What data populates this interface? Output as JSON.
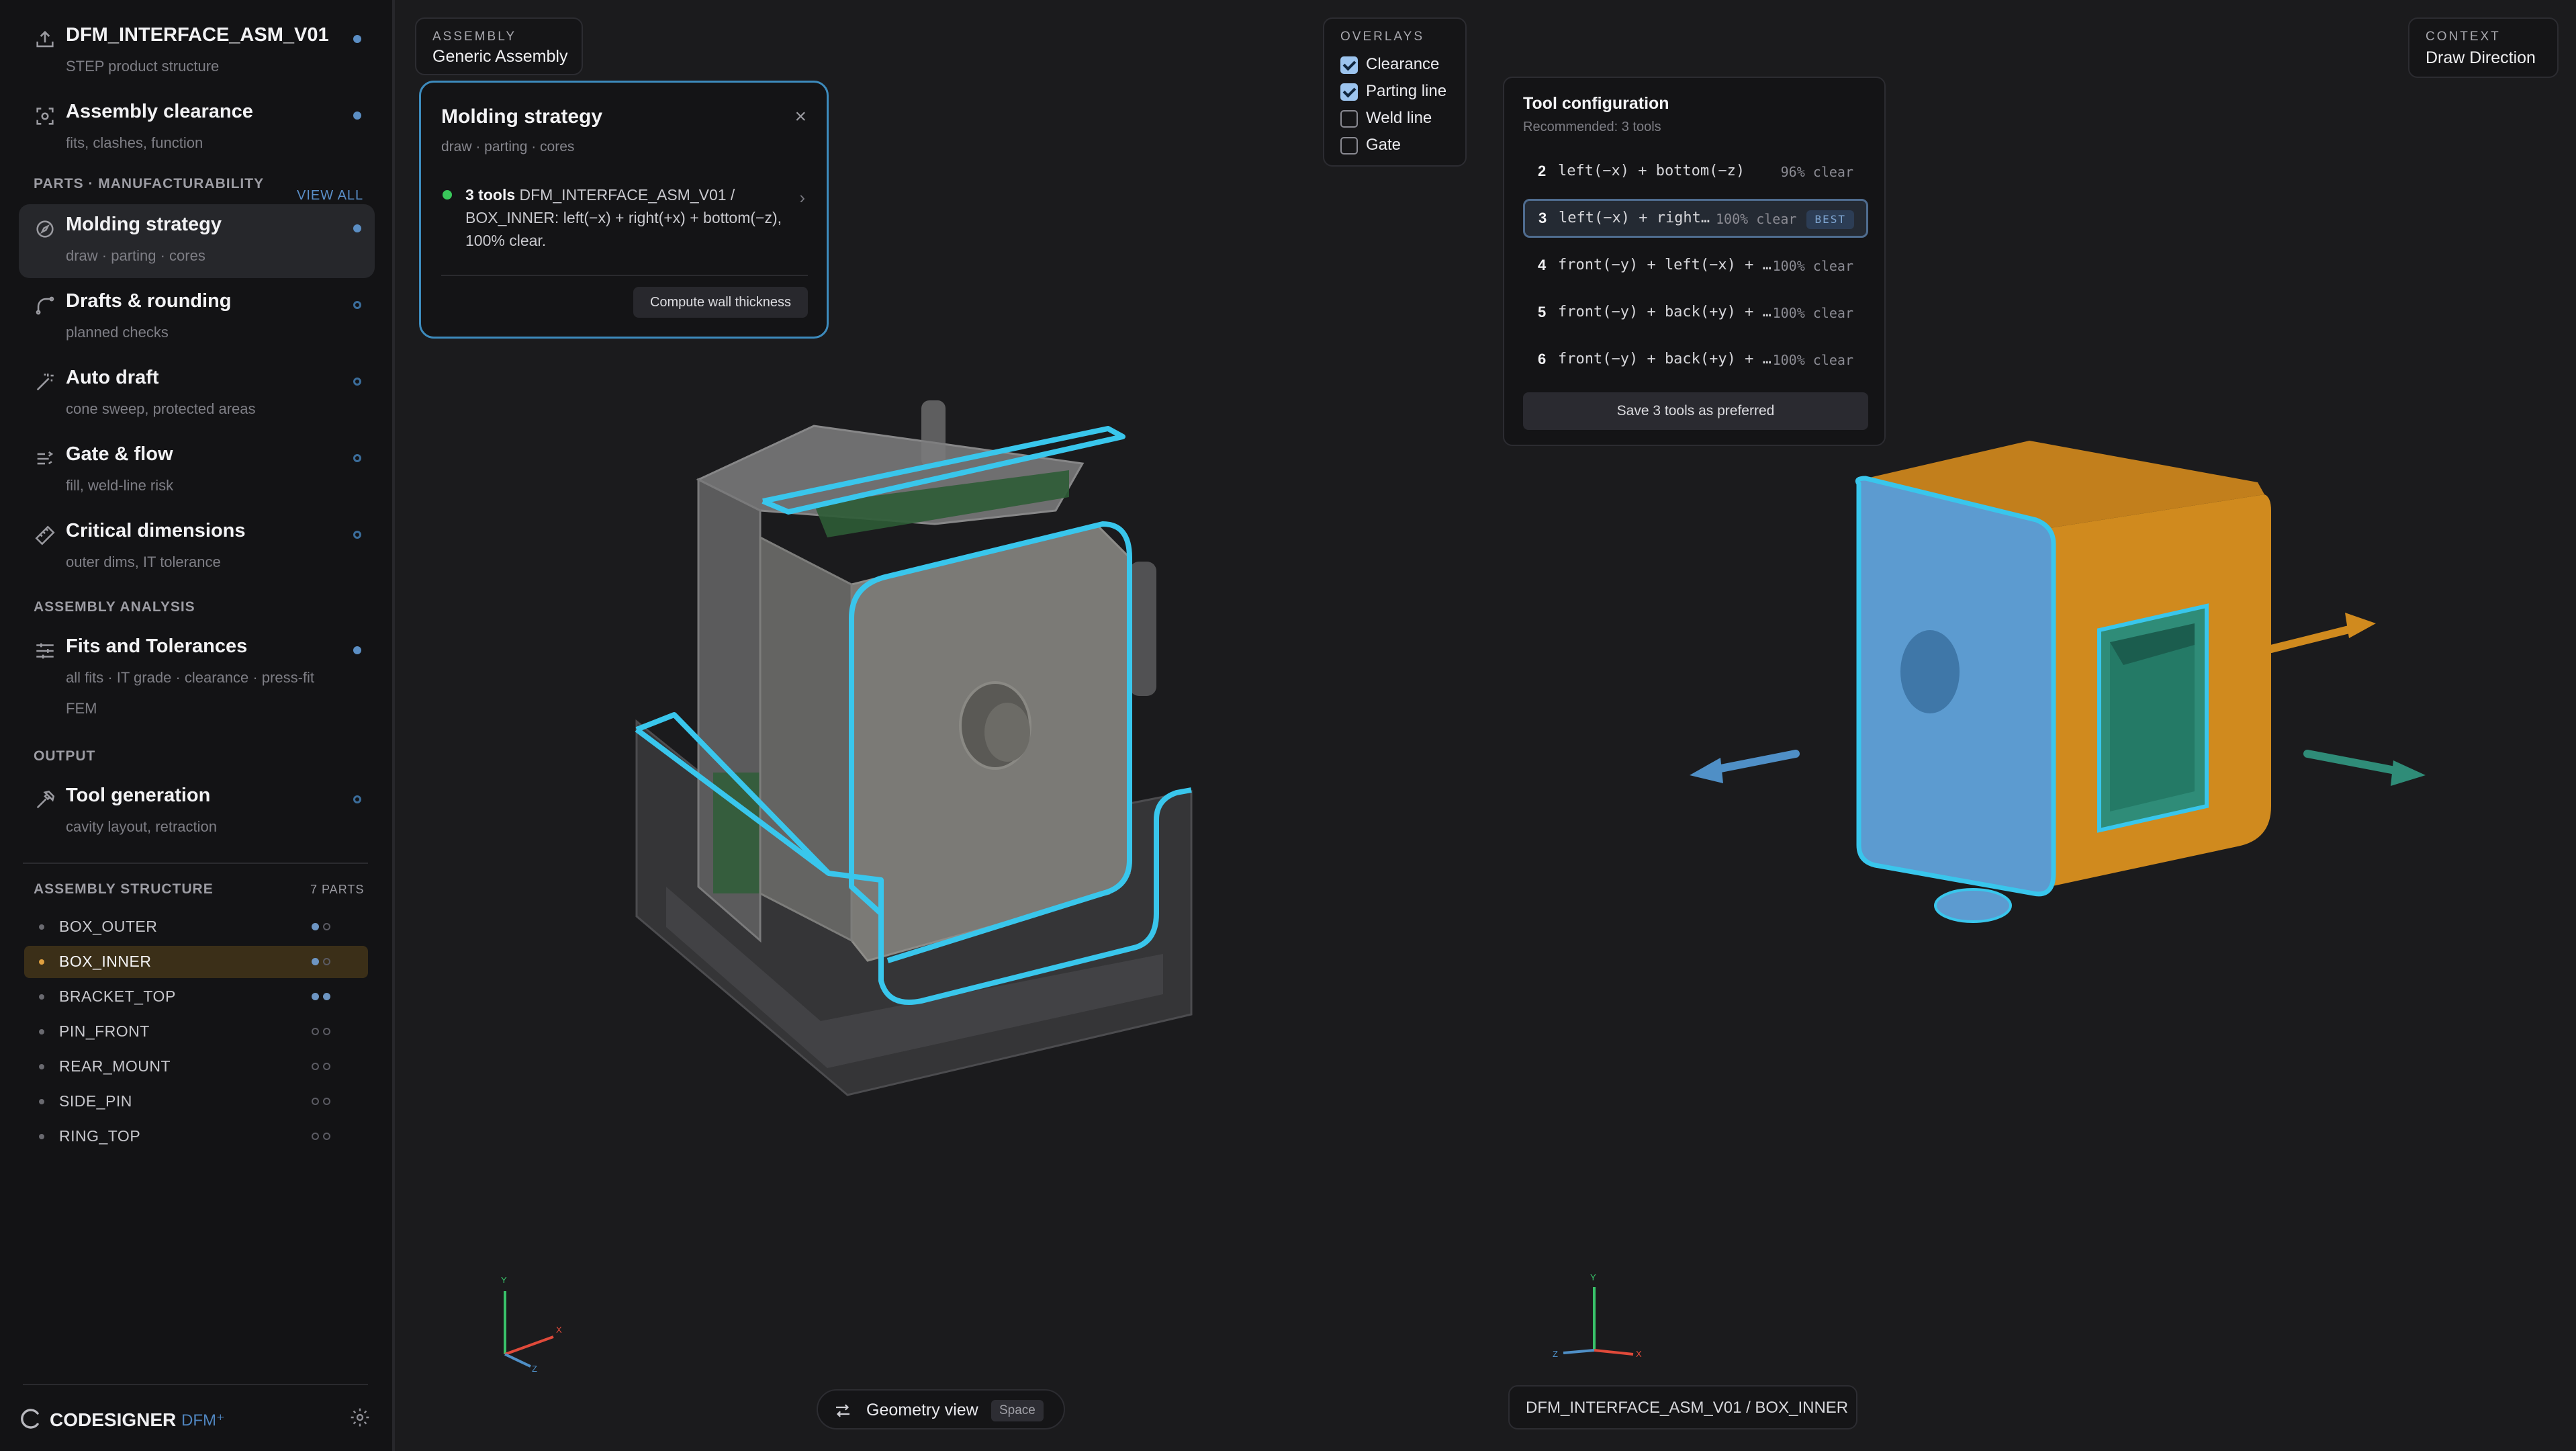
{
  "sidebar": {
    "project": {
      "title": "DFM_INTERFACE_ASM_V01",
      "subtitle": "STEP product structure"
    },
    "assembly_clearance": {
      "title": "Assembly clearance",
      "subtitle": "fits, clashes, function"
    },
    "parts_section": {
      "label": "PARTS · MANUFACTURABILITY",
      "link": "VIEW ALL"
    },
    "parts_items": [
      {
        "title": "Molding strategy",
        "subtitle": "draw · parting · cores"
      },
      {
        "title": "Drafts & rounding",
        "subtitle": "planned checks"
      },
      {
        "title": "Auto draft",
        "subtitle": "cone sweep, protected areas"
      },
      {
        "title": "Gate & flow",
        "subtitle": "fill, weld-line risk"
      },
      {
        "title": "Critical dimensions",
        "subtitle": "outer dims, IT tolerance"
      }
    ],
    "analysis_section": {
      "label": "ASSEMBLY ANALYSIS"
    },
    "fits": {
      "title": "Fits and Tolerances",
      "subtitle1": "all fits · IT grade · clearance · press-fit",
      "subtitle2": "FEM"
    },
    "output_section": {
      "label": "OUTPUT"
    },
    "toolgen": {
      "title": "Tool generation",
      "subtitle": "cavity layout, retraction"
    },
    "structure": {
      "label": "ASSEMBLY STRUCTURE",
      "count": "7 PARTS",
      "parts": [
        "BOX_OUTER",
        "BOX_INNER",
        "BRACKET_TOP",
        "PIN_FRONT",
        "REAR_MOUNT",
        "SIDE_PIN",
        "RING_TOP"
      ],
      "selected_index": 1
    },
    "brand": {
      "name": "CODESIGNER",
      "suffix": "DFM⁺"
    }
  },
  "assembly_chip": {
    "label": "ASSEMBLY",
    "value": "Generic Assembly"
  },
  "molding_panel": {
    "title": "Molding strategy",
    "subtitle": "draw · parting · cores",
    "result_bold": "3 tools",
    "result_text": " DFM_INTERFACE_ASM_V01 / BOX_INNER: left(−x) + right(+x) + bottom(−z), 100% clear.",
    "action": "Compute wall thickness"
  },
  "overlays": {
    "label": "OVERLAYS",
    "items": [
      {
        "label": "Clearance",
        "checked": true
      },
      {
        "label": "Parting line",
        "checked": true
      },
      {
        "label": "Weld line",
        "checked": false
      },
      {
        "label": "Gate",
        "checked": false
      }
    ]
  },
  "tool_config": {
    "title": "Tool configuration",
    "subtitle": "Recommended: 3 tools",
    "rows": [
      {
        "num": "2",
        "desc": "left(−x) + bottom(−z)",
        "clear": "96% clear"
      },
      {
        "num": "3",
        "desc": "left(−x) + right(+x) ...",
        "clear": "100% clear",
        "badge": "BEST"
      },
      {
        "num": "4",
        "desc": "front(−y) + left(−x) + right(+...",
        "clear": "100% clear"
      },
      {
        "num": "5",
        "desc": "front(−y) + back(+y) + left(−...",
        "clear": "100% clear"
      },
      {
        "num": "6",
        "desc": "front(−y) + back(+y) + left(−...",
        "clear": "100% clear"
      }
    ],
    "save_button": "Save 3 tools as preferred"
  },
  "context_chip": {
    "label": "CONTEXT",
    "value": "Draw Direction"
  },
  "geometry_toggle": {
    "label": "Geometry view",
    "shortcut": "Space"
  },
  "path_chip": {
    "text": "DFM_INTERFACE_ASM_V01 / BOX_INNER"
  },
  "axes": {
    "x": "X",
    "y": "Y",
    "z": "Z"
  },
  "colors": {
    "accent_cyan": "#39c6ec",
    "part_blue": "#5c9bd0",
    "part_orange": "#d08a1e",
    "pocket_teal": "#2f8c78",
    "selected_row": "#3b2f18"
  }
}
